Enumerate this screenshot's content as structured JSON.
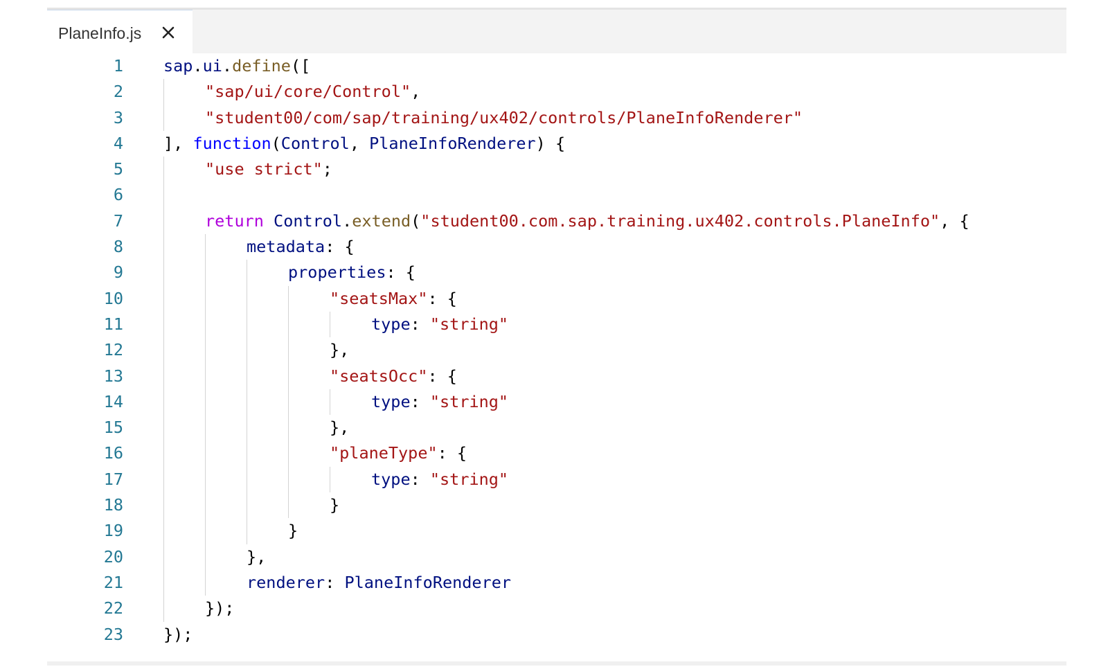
{
  "tab": {
    "filename": "PlaneInfo.js",
    "close_glyph": "✕"
  },
  "colors": {
    "line_number": "#237893",
    "string": "#a31515",
    "keyword": "#0000ff",
    "control_keyword": "#af00db",
    "function": "#795e26",
    "variable": "#001080",
    "indent_guide": "#d3d3d3"
  },
  "lines": [
    {
      "n": "1",
      "indent": 0,
      "tokens": [
        [
          "var",
          "sap"
        ],
        [
          "punc",
          "."
        ],
        [
          "var",
          "ui"
        ],
        [
          "punc",
          "."
        ],
        [
          "fn",
          "define"
        ],
        [
          "punc",
          "(["
        ]
      ]
    },
    {
      "n": "2",
      "indent": 1,
      "tokens": [
        [
          "str",
          "\"sap/ui/core/Control\""
        ],
        [
          "punc",
          ","
        ]
      ]
    },
    {
      "n": "3",
      "indent": 1,
      "tokens": [
        [
          "str",
          "\"student00/com/sap/training/ux402/controls/PlaneInfoRenderer\""
        ]
      ]
    },
    {
      "n": "4",
      "indent": 0,
      "tokens": [
        [
          "punc",
          "], "
        ],
        [
          "kw",
          "function"
        ],
        [
          "punc",
          "("
        ],
        [
          "var",
          "Control"
        ],
        [
          "punc",
          ", "
        ],
        [
          "var",
          "PlaneInfoRenderer"
        ],
        [
          "punc",
          ") {"
        ]
      ]
    },
    {
      "n": "5",
      "indent": 1,
      "tokens": [
        [
          "str",
          "\"use strict\""
        ],
        [
          "punc",
          ";"
        ]
      ]
    },
    {
      "n": "6",
      "indent": 1,
      "tokens": []
    },
    {
      "n": "7",
      "indent": 1,
      "tokens": [
        [
          "ctl",
          "return"
        ],
        [
          "punc",
          " "
        ],
        [
          "var",
          "Control"
        ],
        [
          "punc",
          "."
        ],
        [
          "fn",
          "extend"
        ],
        [
          "punc",
          "("
        ],
        [
          "str",
          "\"student00.com.sap.training.ux402.controls.PlaneInfo\""
        ],
        [
          "punc",
          ", {"
        ]
      ]
    },
    {
      "n": "8",
      "indent": 2,
      "tokens": [
        [
          "prop",
          "metadata"
        ],
        [
          "punc",
          ": {"
        ]
      ]
    },
    {
      "n": "9",
      "indent": 3,
      "tokens": [
        [
          "prop",
          "properties"
        ],
        [
          "punc",
          ": {"
        ]
      ]
    },
    {
      "n": "10",
      "indent": 4,
      "tokens": [
        [
          "str",
          "\"seatsMax\""
        ],
        [
          "punc",
          ": {"
        ]
      ]
    },
    {
      "n": "11",
      "indent": 5,
      "tokens": [
        [
          "prop",
          "type"
        ],
        [
          "punc",
          ": "
        ],
        [
          "str",
          "\"string\""
        ]
      ]
    },
    {
      "n": "12",
      "indent": 4,
      "tokens": [
        [
          "punc",
          "},"
        ]
      ]
    },
    {
      "n": "13",
      "indent": 4,
      "tokens": [
        [
          "str",
          "\"seatsOcc\""
        ],
        [
          "punc",
          ": {"
        ]
      ]
    },
    {
      "n": "14",
      "indent": 5,
      "tokens": [
        [
          "prop",
          "type"
        ],
        [
          "punc",
          ": "
        ],
        [
          "str",
          "\"string\""
        ]
      ]
    },
    {
      "n": "15",
      "indent": 4,
      "tokens": [
        [
          "punc",
          "},"
        ]
      ]
    },
    {
      "n": "16",
      "indent": 4,
      "tokens": [
        [
          "str",
          "\"planeType\""
        ],
        [
          "punc",
          ": {"
        ]
      ]
    },
    {
      "n": "17",
      "indent": 5,
      "tokens": [
        [
          "prop",
          "type"
        ],
        [
          "punc",
          ": "
        ],
        [
          "str",
          "\"string\""
        ]
      ]
    },
    {
      "n": "18",
      "indent": 4,
      "tokens": [
        [
          "punc",
          "}"
        ]
      ]
    },
    {
      "n": "19",
      "indent": 3,
      "tokens": [
        [
          "punc",
          "}"
        ]
      ]
    },
    {
      "n": "20",
      "indent": 2,
      "tokens": [
        [
          "punc",
          "},"
        ]
      ]
    },
    {
      "n": "21",
      "indent": 2,
      "tokens": [
        [
          "prop",
          "renderer"
        ],
        [
          "punc",
          ": "
        ],
        [
          "var",
          "PlaneInfoRenderer"
        ]
      ]
    },
    {
      "n": "22",
      "indent": 1,
      "tokens": [
        [
          "punc",
          "});"
        ]
      ]
    },
    {
      "n": "23",
      "indent": 0,
      "tokens": [
        [
          "punc",
          "});"
        ]
      ]
    }
  ]
}
